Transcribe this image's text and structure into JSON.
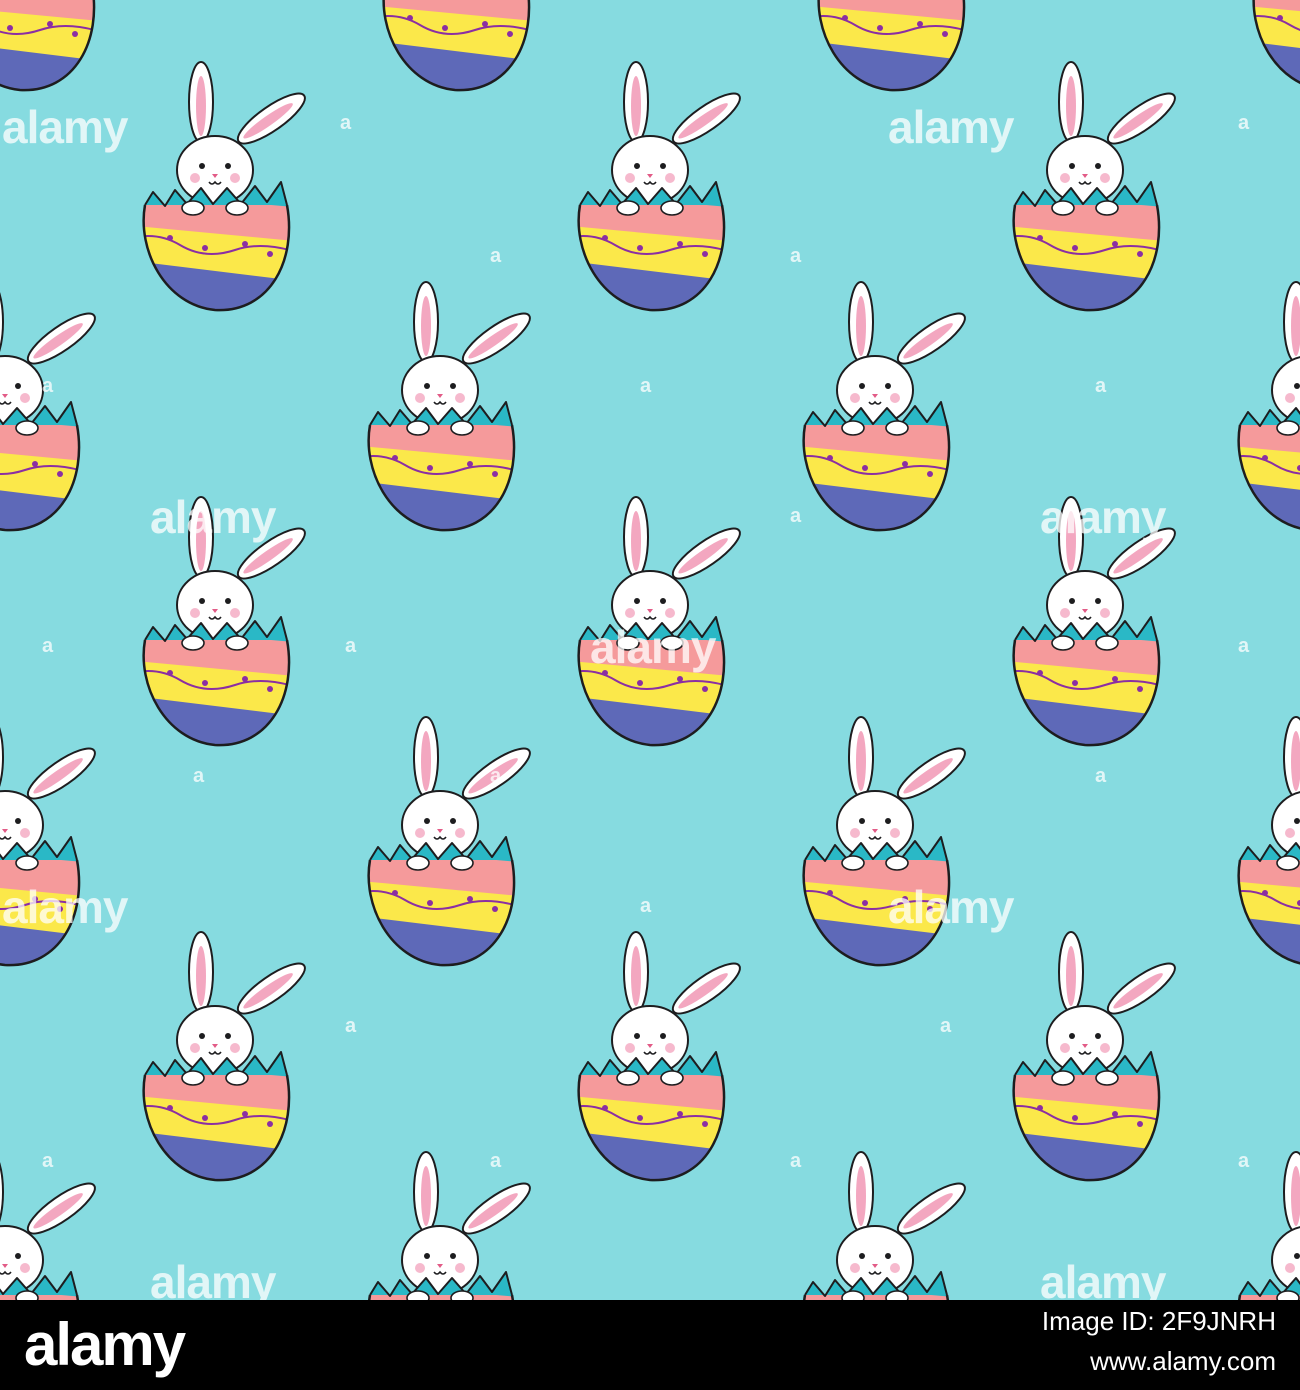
{
  "colors": {
    "background": "#86dbe0",
    "egg_outline": "#1d1d1f",
    "egg_teal": "#2ab8c6",
    "egg_pink": "#f59a9b",
    "egg_yellow": "#fbe84a",
    "egg_blue": "#5e69b8",
    "dots_purple": "#8b2ea3",
    "bunny_white": "#ffffff",
    "ear_inner": "#f3a7c0",
    "cheek": "#f4a7c0",
    "footer_bg": "#000000",
    "footer_text": "#ffffff"
  },
  "pattern": {
    "motif": "bunny-in-easter-egg",
    "icon": "bunny-egg-icon"
  },
  "watermarks": {
    "word": "alamy",
    "mark": "a"
  },
  "footer": {
    "logo": "alamy",
    "image_id": "Image ID: 2F9JNRH",
    "url": "www.alamy.com"
  }
}
